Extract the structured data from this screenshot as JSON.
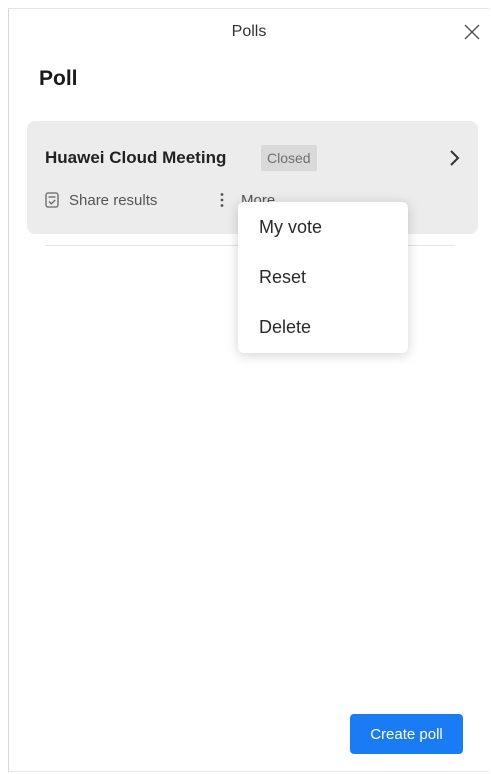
{
  "window": {
    "title": "Polls",
    "close_icon": "close-icon"
  },
  "section": {
    "title": "Poll"
  },
  "poll": {
    "name": "Huawei Cloud Meeting",
    "status": "Closed",
    "share_label": "Share results",
    "more_label": "More",
    "icons": [
      "share-results-icon",
      "more-dots-icon",
      "chevron-right-icon"
    ]
  },
  "dropdown": {
    "items": [
      {
        "label": "My vote"
      },
      {
        "label": "Reset"
      },
      {
        "label": "Delete"
      }
    ]
  },
  "footer": {
    "create_label": "Create poll"
  },
  "colors": {
    "accent": "#1a7cf5",
    "card_bg": "#ececec",
    "badge_bg": "#d9d9d9"
  }
}
